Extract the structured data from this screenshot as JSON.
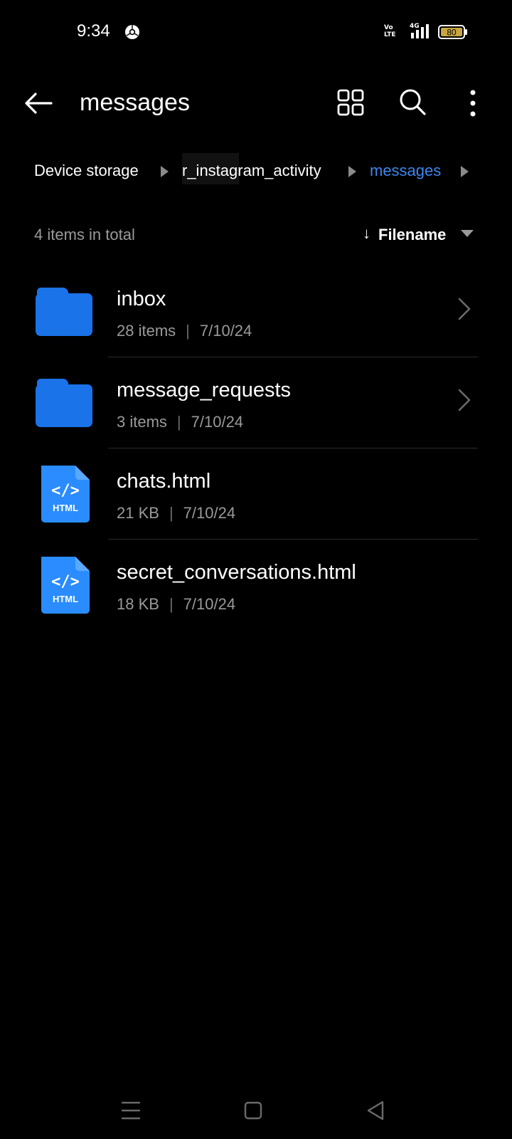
{
  "status_bar": {
    "time": "9:34",
    "volte": "Vo\nLTE",
    "network": "4G",
    "battery": "80"
  },
  "app_bar": {
    "title": "messages",
    "icons": [
      "back-arrow-icon",
      "grid-view-icon",
      "search-icon",
      "more-vert-icon"
    ]
  },
  "breadcrumb": {
    "items": [
      "Device storage",
      "r_instagram_activity",
      "messages"
    ],
    "active_color": "#3d86f0"
  },
  "list_header": {
    "count": "4 items in total",
    "sort_arrow": "↓",
    "sort_label": "Filename"
  },
  "files": [
    {
      "name": "inbox",
      "detail": "28 items",
      "date": "7/10/24",
      "type": "folder"
    },
    {
      "name": "message_requests",
      "detail": "3 items",
      "date": "7/10/24",
      "type": "folder"
    },
    {
      "name": "chats.html",
      "detail": "21 KB",
      "date": "7/10/24",
      "type": "html"
    },
    {
      "name": "secret_conversations.html",
      "detail": "18 KB",
      "date": "7/10/24",
      "type": "html"
    }
  ],
  "file_badge": {
    "html_code": "</>",
    "html_label": "HTML"
  },
  "colors": {
    "accent": "#3d86f0",
    "folder": "#1a73e8",
    "html_file": "#2a8cff",
    "background": "#000000"
  },
  "nav_bar": {
    "icons": [
      "menu-icon",
      "home-square-icon",
      "back-triangle-icon"
    ]
  }
}
